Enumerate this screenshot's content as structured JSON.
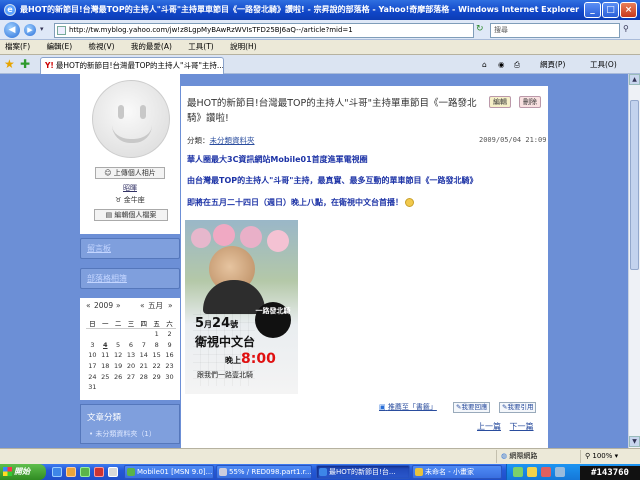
{
  "window": {
    "title": "最HOT的新節目!台灣最TOP的主持人\"斗哥\"主持單車節目《一路發北騎》讚啦! - 宗昇說的部落格 - Yahoo!奇摩部落格 - Windows Internet Explorer",
    "browser_icon": "ie-icon",
    "controls": {
      "minimize": "_",
      "maximize": "□",
      "close": "×"
    }
  },
  "addressbar": {
    "url": "http://tw.myblog.yahoo.com/jw!z8LgpMyBAwRzWVIsTFD25BJ6aQ--/article?mid=1",
    "search_placeholder": "搜尋"
  },
  "menu": [
    "檔案(F)",
    "編輯(E)",
    "檢視(V)",
    "我的最愛(A)",
    "工具(T)",
    "說明(H)"
  ],
  "tab": {
    "label": "最HOT的新節目!台灣最TOP的主持人\"斗哥\"主持...",
    "tools": [
      "網頁(P)",
      "工具(O)"
    ]
  },
  "sidebar": {
    "upload_photo": "上傳個人相片",
    "nickname": "昭暉",
    "zodiac": "金牛座",
    "edit_profile": "編輯個人檔案",
    "guestbook": "留言板",
    "blog_list": "部落格相簿",
    "calendar": {
      "year": "2009",
      "month": "五月",
      "prev": "«",
      "next": "»",
      "weekdays": [
        "日",
        "一",
        "二",
        "三",
        "四",
        "五",
        "六"
      ],
      "weeks": [
        [
          "",
          "",
          "",
          "",
          "",
          "1",
          "2"
        ],
        [
          "3",
          "4",
          "5",
          "6",
          "7",
          "8",
          "9"
        ],
        [
          "10",
          "11",
          "12",
          "13",
          "14",
          "15",
          "16"
        ],
        [
          "17",
          "18",
          "19",
          "20",
          "21",
          "22",
          "23"
        ],
        [
          "24",
          "25",
          "26",
          "27",
          "28",
          "29",
          "30"
        ],
        [
          "31",
          "",
          "",
          "",
          "",
          "",
          ""
        ]
      ]
    },
    "categories_title": "文章分類",
    "category_item": "未分類資料夾（1）"
  },
  "article": {
    "title": "最HOT的新節目!台灣最TOP的主持人\"斗哥\"主持單車節目《一路發北騎》讚啦!",
    "edit_button": "編輯",
    "delete_button": "刪除",
    "category_label": "分類：",
    "category_value": "未分類資料夾",
    "date": "2009/05/04 21:09",
    "para1": "華人圈最大3C資訊網站Mobile01首度進軍電視圈",
    "para2": "由台灣最TOP的主持人\"斗哥\"主持，最真實、最多互動的單車節目《一路發北騎》",
    "para3": "即將在五月二十四日（週日）晚上八點，在衛視中文台首播！",
    "poster": {
      "logo": "一路發北騎",
      "date_num": "5",
      "date_month": "月",
      "date_day": "24",
      "date_suffix": "號",
      "channel": "衛視中文台",
      "time_prefix": "晚上",
      "time": "8:00",
      "slogan": "跟我們一路壹北騎"
    },
    "recommend": "推薦至「書籤」",
    "reply_button": "我要回應",
    "quote_button": "我要引用",
    "prev": "上一篇",
    "next": "下一篇"
  },
  "status": {
    "zone": "網際網路",
    "zoom": "100%"
  },
  "taskbar": {
    "start": "開始",
    "items": [
      {
        "label": "Mobile01 [MSN 9.0]...",
        "active": false
      },
      {
        "label": "55% / RED098.part1.r...",
        "active": false
      },
      {
        "label": "最HOT的新節目!台...",
        "active": true
      },
      {
        "label": "未命名 - 小畫家",
        "active": false
      }
    ]
  },
  "watermark": "#143760"
}
